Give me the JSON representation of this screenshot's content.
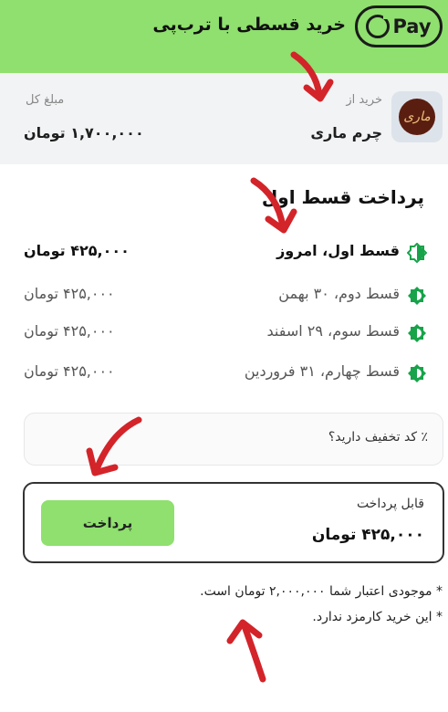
{
  "header": {
    "title": "خرید قسطی با ترب‌پی",
    "logo_text": "Pay",
    "background": "#8fe06e"
  },
  "merchant": {
    "from_label": "خرید از",
    "name": "چرم ماری",
    "logo_text": "ماری",
    "total_label": "مبلغ کل",
    "total_value": "۱,۷۰۰,۰۰۰ تومان"
  },
  "installments": {
    "title": "پرداخت قسط اول",
    "items": [
      {
        "label": "قسط اول، امروز",
        "amount": "۴۲۵,۰۰۰ تومان",
        "active": true
      },
      {
        "label": "قسط دوم، ۳۰ بهمن",
        "amount": "۴۲۵,۰۰۰ تومان",
        "active": false
      },
      {
        "label": "قسط سوم، ۲۹ اسفند",
        "amount": "۴۲۵,۰۰۰ تومان",
        "active": false
      },
      {
        "label": "قسط چهارم، ۳۱ فروردین",
        "amount": "۴۲۵,۰۰۰ تومان",
        "active": false
      }
    ]
  },
  "discount": {
    "label": "٪ کد تخفیف دارید؟"
  },
  "payment": {
    "payable_label": "قابل پرداخت",
    "payable_amount": "۴۲۵,۰۰۰ تومان",
    "pay_button": "پرداخت"
  },
  "notes": [
    "* موجودی اعتبار شما ۲,۰۰۰,۰۰۰ تومان است.",
    "* این خرید کارمزد ندارد."
  ],
  "colors": {
    "accent": "#8fe06e",
    "annotation_arrow": "#d3242a",
    "icon_fill": "#18a34a"
  }
}
